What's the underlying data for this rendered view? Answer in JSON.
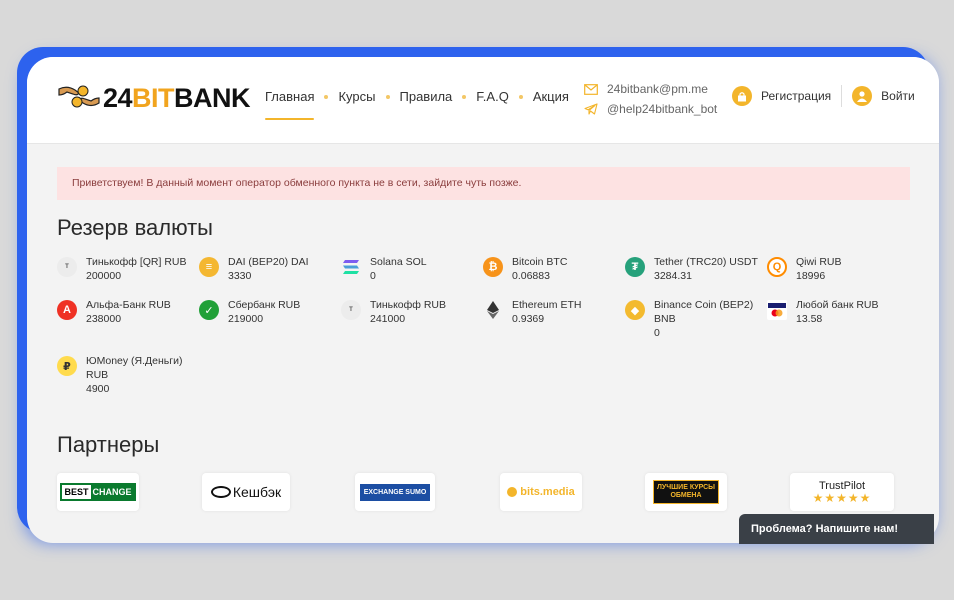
{
  "logo": {
    "number": "24",
    "word_accent": "BIT",
    "word_rest": "BANK"
  },
  "nav": [
    {
      "label": "Главная",
      "active": true
    },
    {
      "label": "Курсы"
    },
    {
      "label": "Правила"
    },
    {
      "label": "F.A.Q"
    },
    {
      "label": "Акция"
    }
  ],
  "contacts": {
    "email": "24bitbank@pm.me",
    "telegram": "@help24bitbank_bot"
  },
  "auth": {
    "register": "Регистрация",
    "login": "Войти"
  },
  "alert": "Приветствуем! В данный момент оператор обменного пункта не в сети, зайдите чуть позже.",
  "reserve": {
    "title": "Резерв валюты",
    "items": [
      {
        "name": "Тинькофф [QR] RUB",
        "amount": "200000",
        "icon": "tinkoff-icon",
        "color": "#ececec"
      },
      {
        "name": "DAI (BEP20) DAI",
        "amount": "3330",
        "icon": "dai-icon",
        "color": "#f4b731"
      },
      {
        "name": "Solana SOL",
        "amount": "0",
        "icon": "solana-icon",
        "color": "#ffffff"
      },
      {
        "name": "Bitcoin BTC",
        "amount": "0.06883",
        "icon": "bitcoin-icon",
        "color": "#f7931a"
      },
      {
        "name": "Tether (TRC20) USDT",
        "amount": "3284.31",
        "icon": "tether-icon",
        "color": "#26a17b"
      },
      {
        "name": "Qiwi RUB",
        "amount": "18996",
        "icon": "qiwi-icon",
        "color": "#ffffff"
      },
      {
        "name": "Альфа-Банк RUB",
        "amount": "238000",
        "icon": "alfa-icon",
        "color": "#ef3124"
      },
      {
        "name": "Сбербанк RUB",
        "amount": "219000",
        "icon": "sber-icon",
        "color": "#21a038"
      },
      {
        "name": "Тинькофф RUB",
        "amount": "241000",
        "icon": "tinkoff-icon",
        "color": "#ececec"
      },
      {
        "name": "Ethereum ETH",
        "amount": "0.9369",
        "icon": "ethereum-icon",
        "color": "#ffffff"
      },
      {
        "name": "Binance Coin (BEP2) BNB",
        "amount": "0",
        "icon": "binance-icon",
        "color": "#f3ba2f"
      },
      {
        "name": "Любой банк RUB",
        "amount": "13.58",
        "icon": "card-icon",
        "color": "#ffffff"
      },
      {
        "name": "ЮMoney (Я.Деньги) RUB",
        "amount": "4900",
        "icon": "yoomoney-icon",
        "color": "#ffdb4d"
      }
    ]
  },
  "partners": {
    "title": "Партнеры",
    "items": [
      {
        "name": "BEST CHANGE",
        "icon": "bestchange-logo"
      },
      {
        "name": "Кешбэк",
        "icon": "cashback-logo"
      },
      {
        "name": "EXCHANGE SUMO",
        "icon": "exchangesumo-logo"
      },
      {
        "name": "bits.media",
        "icon": "bitsmedia-logo"
      },
      {
        "name": "ЛУЧШИЕ КУРСЫ ОБМЕНА",
        "icon": "best-rates-logo"
      },
      {
        "name": "TrustPilot",
        "icon": "trustpilot-logo",
        "stars": "★★★★★"
      }
    ]
  },
  "chat": {
    "label": "Проблема? Напишите нам!"
  }
}
